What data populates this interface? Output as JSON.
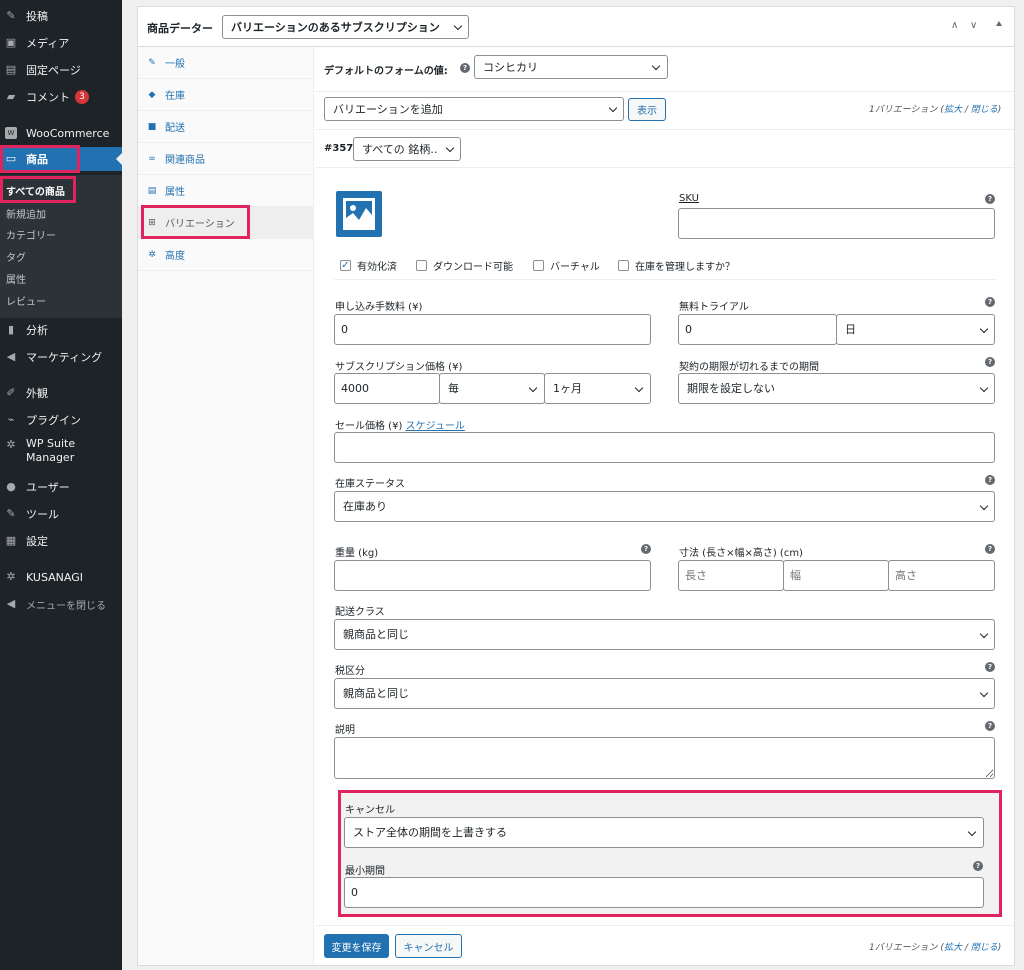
{
  "sidebar": {
    "items": [
      {
        "label": "投稿",
        "icon": "pin-icon"
      },
      {
        "label": "メディア",
        "icon": "media-icon"
      },
      {
        "label": "固定ページ",
        "icon": "page-icon"
      },
      {
        "label": "コメント",
        "icon": "comment-icon",
        "badge": "3"
      },
      {
        "label": "WooCommerce",
        "icon": "woo-icon"
      },
      {
        "label": "商品",
        "icon": "archive-icon"
      },
      {
        "label": "分析",
        "icon": "chart-icon"
      },
      {
        "label": "マーケティング",
        "icon": "megaphone-icon"
      },
      {
        "label": "外観",
        "icon": "brush-icon"
      },
      {
        "label": "プラグイン",
        "icon": "plugin-icon"
      },
      {
        "label": "WP Suite Manager",
        "icon": "gear-icon"
      },
      {
        "label": "ユーザー",
        "icon": "user-icon"
      },
      {
        "label": "ツール",
        "icon": "wrench-icon"
      },
      {
        "label": "設定",
        "icon": "settings-icon"
      },
      {
        "label": "KUSANAGI",
        "icon": "gear-icon"
      },
      {
        "label": "メニューを閉じる",
        "icon": "collapse-icon"
      }
    ],
    "submenu": [
      "すべての商品",
      "新規追加",
      "カテゴリー",
      "タグ",
      "属性",
      "レビュー"
    ]
  },
  "header": {
    "title": "商品データー",
    "product_type": "バリエーションのあるサブスクリプション"
  },
  "tabs": [
    {
      "label": "一般",
      "icon": "wrench-icon"
    },
    {
      "label": "在庫",
      "icon": "tag-icon"
    },
    {
      "label": "配送",
      "icon": "truck-icon"
    },
    {
      "label": "関連商品",
      "icon": "link-icon"
    },
    {
      "label": "属性",
      "icon": "list-icon"
    },
    {
      "label": "バリエーション",
      "icon": "grid-icon"
    },
    {
      "label": "高度",
      "icon": "gear-icon"
    }
  ],
  "defaults": {
    "label": "デフォルトのフォームの値:",
    "value": "コシヒカリ"
  },
  "toolbar": {
    "add_select": "バリエーションを追加",
    "show_button": "表示",
    "count_text": "1バリエーション",
    "expand": "拡大",
    "sep": "/",
    "close": "閉じる"
  },
  "variation": {
    "id": "#357",
    "attribute": "すべての 銘柄…",
    "sku_label": "SKU",
    "checkboxes": [
      {
        "label": "有効化済",
        "checked": true
      },
      {
        "label": "ダウンロード可能",
        "checked": false
      },
      {
        "label": "バーチャル",
        "checked": false
      },
      {
        "label": "在庫を管理しますか？",
        "checked": false
      }
    ],
    "signup_fee_label": "申し込み手数料 (¥)",
    "signup_fee_value": "0",
    "trial_label": "無料トライアル",
    "trial_value": "0",
    "trial_unit": "日",
    "price_label": "サブスクリプション価格 (¥)",
    "price_value": "4000",
    "price_interval": "毎",
    "price_period": "1ヶ月",
    "length_label": "契約の期限が切れるまでの期間",
    "length_value": "期限を設定しない",
    "sale_label": "セール価格 (¥)",
    "sale_schedule": "スケジュール",
    "stock_status_label": "在庫ステータス",
    "stock_status_value": "在庫あり",
    "weight_label": "重量 (kg)",
    "dimensions_label": "寸法 (長さ×幅×高さ) (cm)",
    "length_ph": "長さ",
    "width_ph": "幅",
    "height_ph": "高さ",
    "shipping_label": "配送クラス",
    "shipping_value": "親商品と同じ",
    "tax_label": "税区分",
    "tax_value": "親商品と同じ",
    "desc_label": "説明",
    "cancel_label": "キャンセル",
    "cancel_value": "ストア全体の期間を上書きする",
    "min_period_label": "最小期間",
    "min_period_value": "0"
  },
  "footer": {
    "save": "変更を保存",
    "cancel": "キャンセル"
  },
  "colors": {
    "accent": "#2271b1",
    "highlight": "#e0245e",
    "sidebar": "#1d2327"
  }
}
